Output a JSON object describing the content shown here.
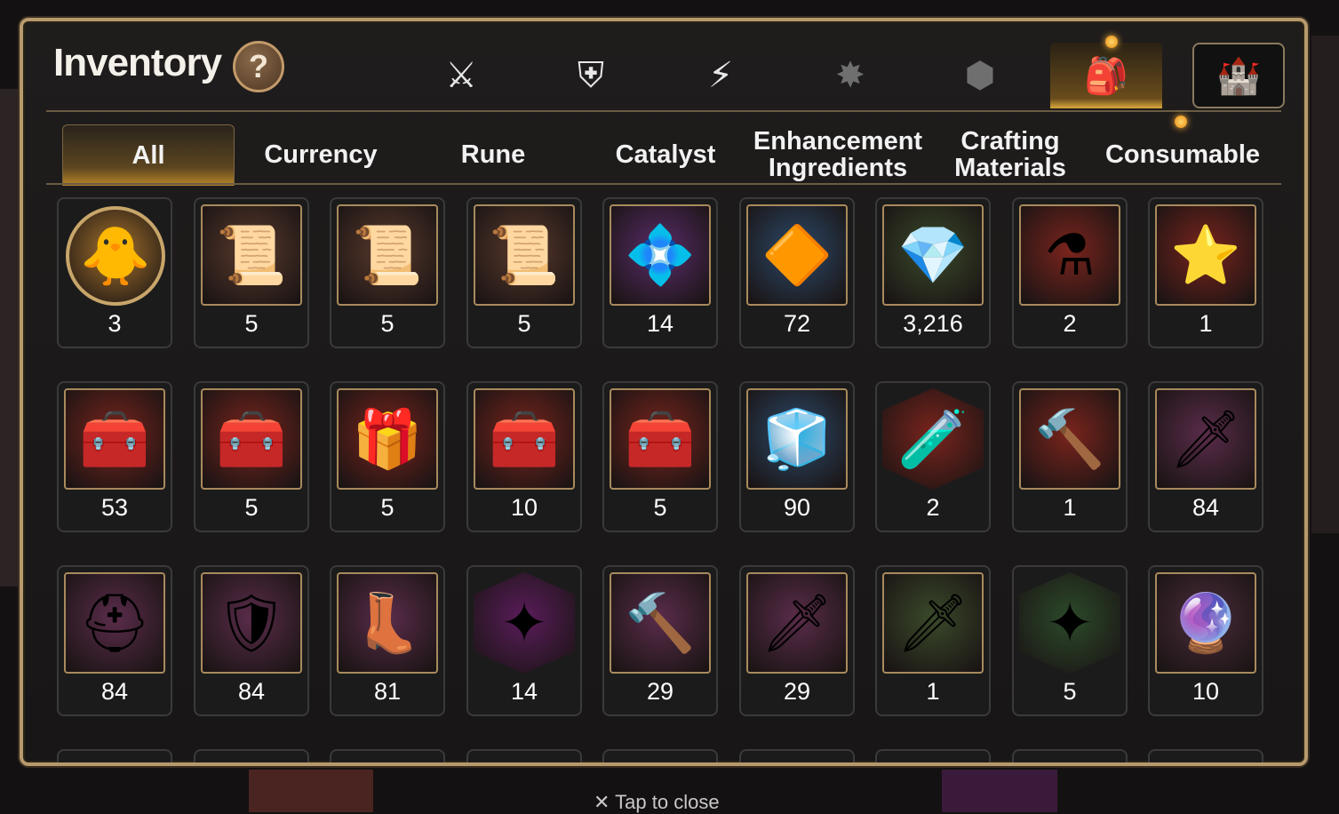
{
  "header": {
    "title": "Inventory",
    "help_label": "?"
  },
  "category_tabs": [
    {
      "icon": "sword-shield-icon",
      "glyph": "⚔",
      "active": false
    },
    {
      "icon": "broken-shield-icon",
      "glyph": "⛨",
      "active": false
    },
    {
      "icon": "lightning-icon",
      "glyph": "⚡",
      "active": false
    },
    {
      "icon": "burst-icon",
      "glyph": "✸",
      "active": false,
      "dim": true
    },
    {
      "icon": "cube-icon",
      "glyph": "⬢",
      "active": false,
      "dim": true
    },
    {
      "icon": "backpack-icon",
      "glyph": "🎒",
      "active": true
    },
    {
      "icon": "castle-icon",
      "glyph": "🏰",
      "active": false
    }
  ],
  "sub_tabs": [
    "All",
    "Currency",
    "Rune",
    "Catalyst",
    "Enhancement Ingredients",
    "Crafting Materials",
    "Consumable"
  ],
  "active_sub_tab": "All",
  "items": [
    {
      "name": "portrait-token-icon",
      "glyph": "🐥",
      "count": "3",
      "bg": "#a8742c",
      "shape": "round"
    },
    {
      "name": "scroll-upgrade-icon",
      "glyph": "📜",
      "count": "5",
      "bg": "#5a3a2c"
    },
    {
      "name": "rainbow-scroll-upgrade-icon",
      "glyph": "📜",
      "count": "5",
      "bg": "#5a3a2c"
    },
    {
      "name": "scroll-upgrade-icon",
      "glyph": "📜",
      "count": "5",
      "bg": "#5a3a2c"
    },
    {
      "name": "purple-crystal-icon",
      "glyph": "💠",
      "count": "14",
      "bg": "#5a2c6a"
    },
    {
      "name": "gold-crystal-icon",
      "glyph": "🔶",
      "count": "72",
      "bg": "#2c4a6a"
    },
    {
      "name": "silver-crystal-icon",
      "glyph": "💎",
      "count": "3,216",
      "bg": "#3a4a2a"
    },
    {
      "name": "red-potion-icon",
      "glyph": "⚗",
      "count": "2",
      "bg": "#7a241c"
    },
    {
      "name": "star-potion-icon",
      "glyph": "⭐",
      "count": "1",
      "bg": "#7a241c"
    },
    {
      "name": "silver-chest-icon",
      "glyph": "🧰",
      "count": "53",
      "bg": "#7a241c"
    },
    {
      "name": "blue-chest-icon",
      "glyph": "🧰",
      "count": "5",
      "bg": "#7a241c"
    },
    {
      "name": "red-chest-icon",
      "glyph": "🎁",
      "count": "5",
      "bg": "#7a241c"
    },
    {
      "name": "gold-chest-icon",
      "glyph": "🧰",
      "count": "10",
      "bg": "#7a241c"
    },
    {
      "name": "gold-chest-icon",
      "glyph": "🧰",
      "count": "5",
      "bg": "#7a241c"
    },
    {
      "name": "dark-cube-chest-icon",
      "glyph": "🧊",
      "count": "90",
      "bg": "#2c4a6a"
    },
    {
      "name": "pink-potion-icon",
      "glyph": "🧪",
      "count": "2",
      "bg": "#7a241c",
      "shape": "hex"
    },
    {
      "name": "hammer-rune-icon",
      "glyph": "🔨",
      "count": "1",
      "bg": "#7a241c"
    },
    {
      "name": "sword-rune-stone-icon",
      "glyph": "🗡",
      "count": "84",
      "bg": "#5a2c4a"
    },
    {
      "name": "helmet-rune-stone-icon",
      "glyph": "⛑",
      "count": "84",
      "bg": "#5a2c4a"
    },
    {
      "name": "armor-rune-stone-icon",
      "glyph": "🛡",
      "count": "84",
      "bg": "#5a2c4a"
    },
    {
      "name": "boot-rune-stone-icon",
      "glyph": "👢",
      "count": "81",
      "bg": "#5a2c4a"
    },
    {
      "name": "star-rune-stone-icon",
      "glyph": "✦",
      "count": "14",
      "bg": "#5a1c5a",
      "shape": "hex"
    },
    {
      "name": "gold-hammer-stone-icon",
      "glyph": "🔨",
      "count": "29",
      "bg": "#5a2c4a"
    },
    {
      "name": "gold-blade-stone-icon",
      "glyph": "🗡",
      "count": "29",
      "bg": "#5a2c4a"
    },
    {
      "name": "pale-sword-stone-icon",
      "glyph": "🗡",
      "count": "1",
      "bg": "#3a4a2a"
    },
    {
      "name": "pale-star-stone-icon",
      "glyph": "✦",
      "count": "5",
      "bg": "#2c4a2a",
      "shape": "hex"
    },
    {
      "name": "pink-gem-icon",
      "glyph": "🔮",
      "count": "10",
      "bg": "#4a2c3a"
    }
  ],
  "footer": {
    "close_hint": "Tap to close",
    "close_icon": "close-icon"
  }
}
